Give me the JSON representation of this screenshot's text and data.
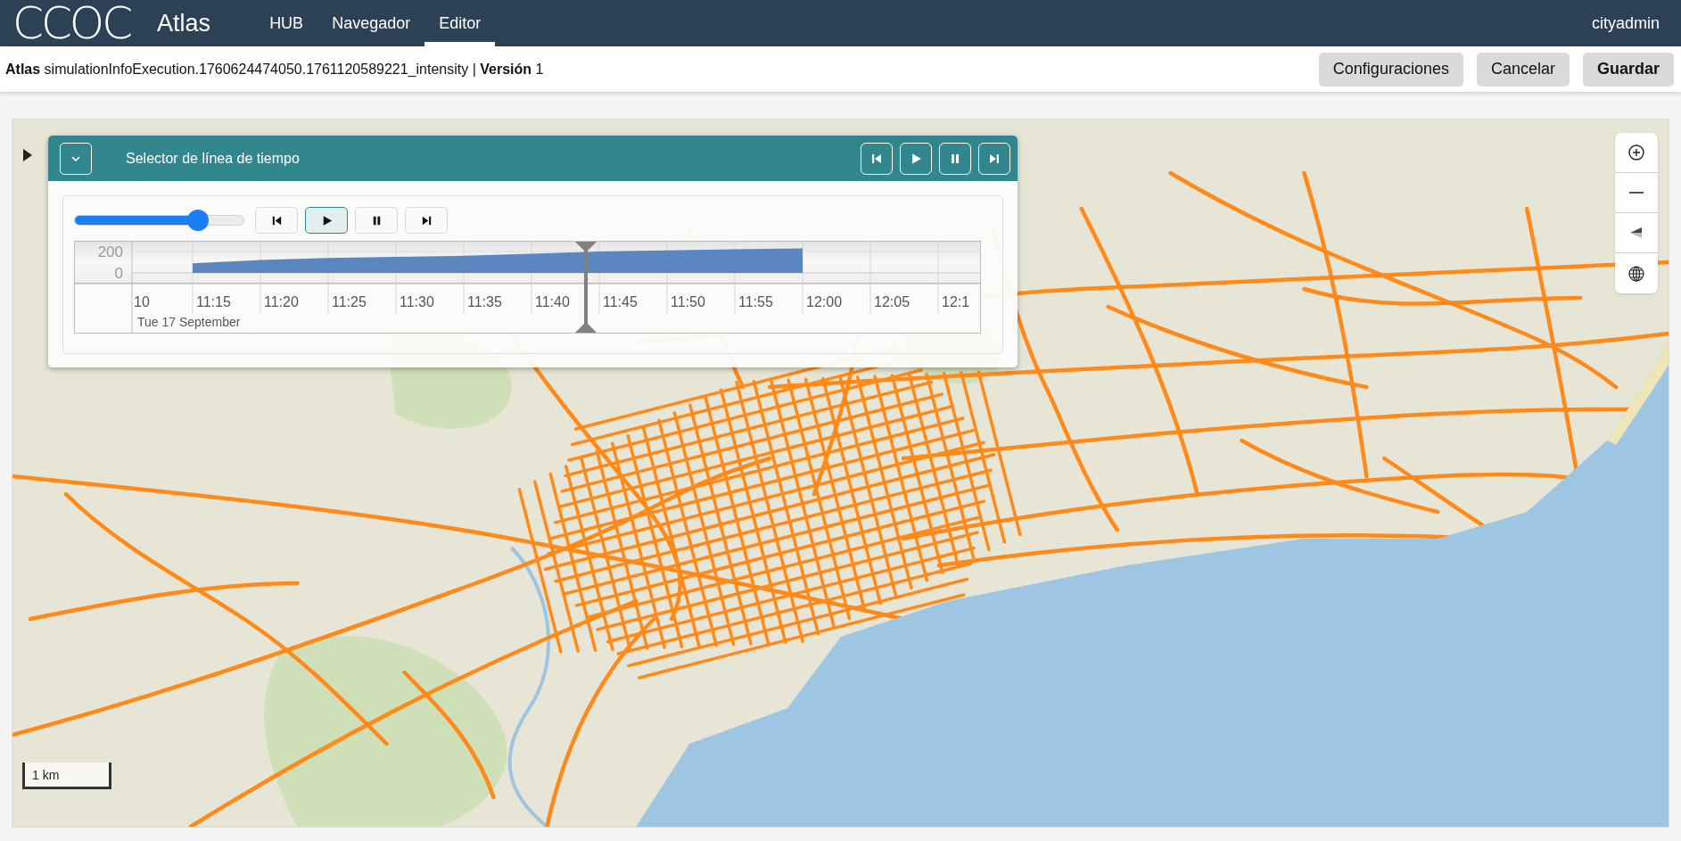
{
  "topbar": {
    "logo": "CCOC",
    "app_name": "Atlas",
    "tabs": [
      {
        "label": "HUB",
        "selected": false
      },
      {
        "label": "Navegador",
        "selected": false
      },
      {
        "label": "Editor",
        "selected": true
      }
    ],
    "user": "cityadmin"
  },
  "document_bar": {
    "title": "**Atlas** simulationInfoExecution.1760624474050.1761120589221_intensity | **Versión** 1",
    "buttons": [
      {
        "label": "Configuraciones",
        "kind": "secondary"
      },
      {
        "label": "Cancelar",
        "kind": "secondary"
      },
      {
        "label": "Guardar",
        "kind": "primary"
      }
    ]
  },
  "map": {
    "scale_label": "1 km",
    "controls": [
      {
        "kind": "zoom-in"
      },
      {
        "kind": "zoom-out"
      },
      {
        "kind": "compass"
      },
      {
        "kind": "globe"
      }
    ]
  },
  "timeline_panel": {
    "title": "Selector de línea de tiempo",
    "header_buttons": [
      {
        "kind": "first"
      },
      {
        "kind": "play"
      },
      {
        "kind": "pause"
      },
      {
        "kind": "last"
      }
    ],
    "speed_slider": {
      "level": 0.73
    },
    "playback_buttons": [
      {
        "kind": "first",
        "selected": false
      },
      {
        "kind": "play",
        "selected": true
      },
      {
        "kind": "pause",
        "selected": false
      },
      {
        "kind": "last",
        "selected": false
      }
    ],
    "date_label": "Tue 17 September",
    "time_cursor": {
      "level": 0.535
    },
    "chart_data": {
      "type": "area",
      "categories": [
        "10",
        "11:15",
        "11:20",
        "11:25",
        "11:30",
        "11:35",
        "11:40",
        "11:45",
        "11:50",
        "11:55",
        "12:00",
        "12:05",
        "12:1"
      ],
      "series": [
        {
          "color": "#5b87c0",
          "values": [
            null,
            90,
            120,
            140,
            150,
            160,
            180,
            200,
            210,
            220,
            230,
            null,
            null
          ]
        }
      ],
      "ylim": [
        0,
        300
      ],
      "yticks": [
        0,
        200
      ]
    }
  }
}
